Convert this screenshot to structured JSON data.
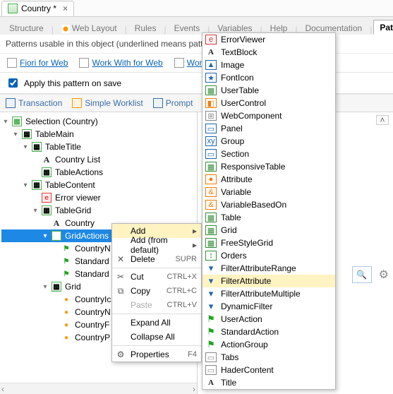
{
  "file_tab": {
    "title": "Country *"
  },
  "editor_tabs": {
    "items": [
      {
        "label": "Structure"
      },
      {
        "label": "Web Layout"
      },
      {
        "label": "Rules"
      },
      {
        "label": "Events"
      },
      {
        "label": "Variables"
      },
      {
        "label": "Help"
      },
      {
        "label": "Documentation"
      },
      {
        "label": "Patterns *"
      }
    ],
    "active_index": 7
  },
  "info_text": "Patterns usable in this object (underlined means pattern",
  "pattern_links": [
    {
      "label": "Fiori for Web"
    },
    {
      "label": "Work With for Web"
    },
    {
      "label": "Work Wit"
    }
  ],
  "apply_checkbox": {
    "label": "Apply this pattern on save",
    "checked": true
  },
  "toolbar": [
    {
      "label": "Transaction"
    },
    {
      "label": "Simple Worklist"
    },
    {
      "label": "Prompt"
    }
  ],
  "tree": {
    "root": {
      "label": "Selection (Country)"
    },
    "n0": {
      "label": "TableMain"
    },
    "n1": {
      "label": "TableTitle"
    },
    "n2": {
      "label": "Country List"
    },
    "n3": {
      "label": "TableActions"
    },
    "n4": {
      "label": "TableContent"
    },
    "n5": {
      "label": "Error viewer"
    },
    "n6": {
      "label": "TableGrid"
    },
    "n7": {
      "label": "Country"
    },
    "n8": {
      "label": "GridActions"
    },
    "n9": {
      "label": "CountryN"
    },
    "n10": {
      "label": "Standard"
    },
    "n11": {
      "label": "Standard"
    },
    "n12": {
      "label": "Grid"
    },
    "n13": {
      "label": "CountryIc"
    },
    "n14": {
      "label": "CountryN"
    },
    "n15": {
      "label": "CountryF"
    },
    "n16": {
      "label": "CountryP"
    }
  },
  "context_menu": {
    "items": [
      {
        "label": "Add",
        "submenu": true,
        "highlight": true
      },
      {
        "label": "Add (from default)",
        "submenu": true
      },
      {
        "label": "Delete",
        "shortcut": "SUPR",
        "icon": "✕"
      },
      {
        "label": "Cut",
        "shortcut": "CTRL+X",
        "icon": "✂"
      },
      {
        "label": "Copy",
        "shortcut": "CTRL+C",
        "icon": "⧉"
      },
      {
        "label": "Paste",
        "shortcut": "CTRL+V",
        "disabled": true
      },
      {
        "label": "Expand All"
      },
      {
        "label": "Collapse All"
      },
      {
        "label": "Properties",
        "shortcut": "F4",
        "icon": "⚙"
      }
    ]
  },
  "add_menu": {
    "highlight_index": 17,
    "items": [
      {
        "label": "ErrorViewer",
        "icon": "e",
        "cls": "red"
      },
      {
        "label": "TextBlock",
        "icon": "A",
        "cls": "a"
      },
      {
        "label": "Image",
        "icon": "▲",
        "cls": "blu"
      },
      {
        "label": "FontIcon",
        "icon": "★",
        "cls": "blu"
      },
      {
        "label": "UserTable",
        "icon": "▦",
        "cls": "grn"
      },
      {
        "label": "UserControl",
        "icon": "◧",
        "cls": "org"
      },
      {
        "label": "WebComponent",
        "icon": "⊞",
        "cls": "gry"
      },
      {
        "label": "Panel",
        "icon": "▭",
        "cls": "blu"
      },
      {
        "label": "Group",
        "icon": "xy",
        "cls": "blu"
      },
      {
        "label": "Section",
        "icon": "▭",
        "cls": "blu"
      },
      {
        "label": "ResponsiveTable",
        "icon": "▦",
        "cls": "grn"
      },
      {
        "label": "Attribute",
        "icon": "●",
        "cls": "org"
      },
      {
        "label": "Variable",
        "icon": "&",
        "cls": "org"
      },
      {
        "label": "VariableBasedOn",
        "icon": "&",
        "cls": "org"
      },
      {
        "label": "Table",
        "icon": "▦",
        "cls": "grn"
      },
      {
        "label": "Grid",
        "icon": "▦",
        "cls": "grn"
      },
      {
        "label": "FreeStyleGrid",
        "icon": "▦",
        "cls": "grn"
      },
      {
        "label": "Orders",
        "icon": "↕",
        "cls": "grn"
      },
      {
        "label": "FilterAttributeRange",
        "icon": "▾",
        "cls": "fnl"
      },
      {
        "label": "FilterAttribute",
        "icon": "▾",
        "cls": "fnl"
      },
      {
        "label": "FilterAttributeMultiple",
        "icon": "▾",
        "cls": "fnl"
      },
      {
        "label": "DynamicFilter",
        "icon": "▾",
        "cls": "fnl"
      },
      {
        "label": "UserAction",
        "icon": "⚑",
        "cls": "flag"
      },
      {
        "label": "StandardAction",
        "icon": "⚑",
        "cls": "flag"
      },
      {
        "label": "ActionGroup",
        "icon": "⚑",
        "cls": "flag"
      },
      {
        "label": "Tabs",
        "icon": "▭",
        "cls": "gry"
      },
      {
        "label": "HaderContent",
        "icon": "▭",
        "cls": "gry"
      },
      {
        "label": "Title",
        "icon": "A",
        "cls": "a"
      }
    ]
  },
  "scroll": {
    "left": "‹",
    "right": "›"
  },
  "chart_data": null
}
